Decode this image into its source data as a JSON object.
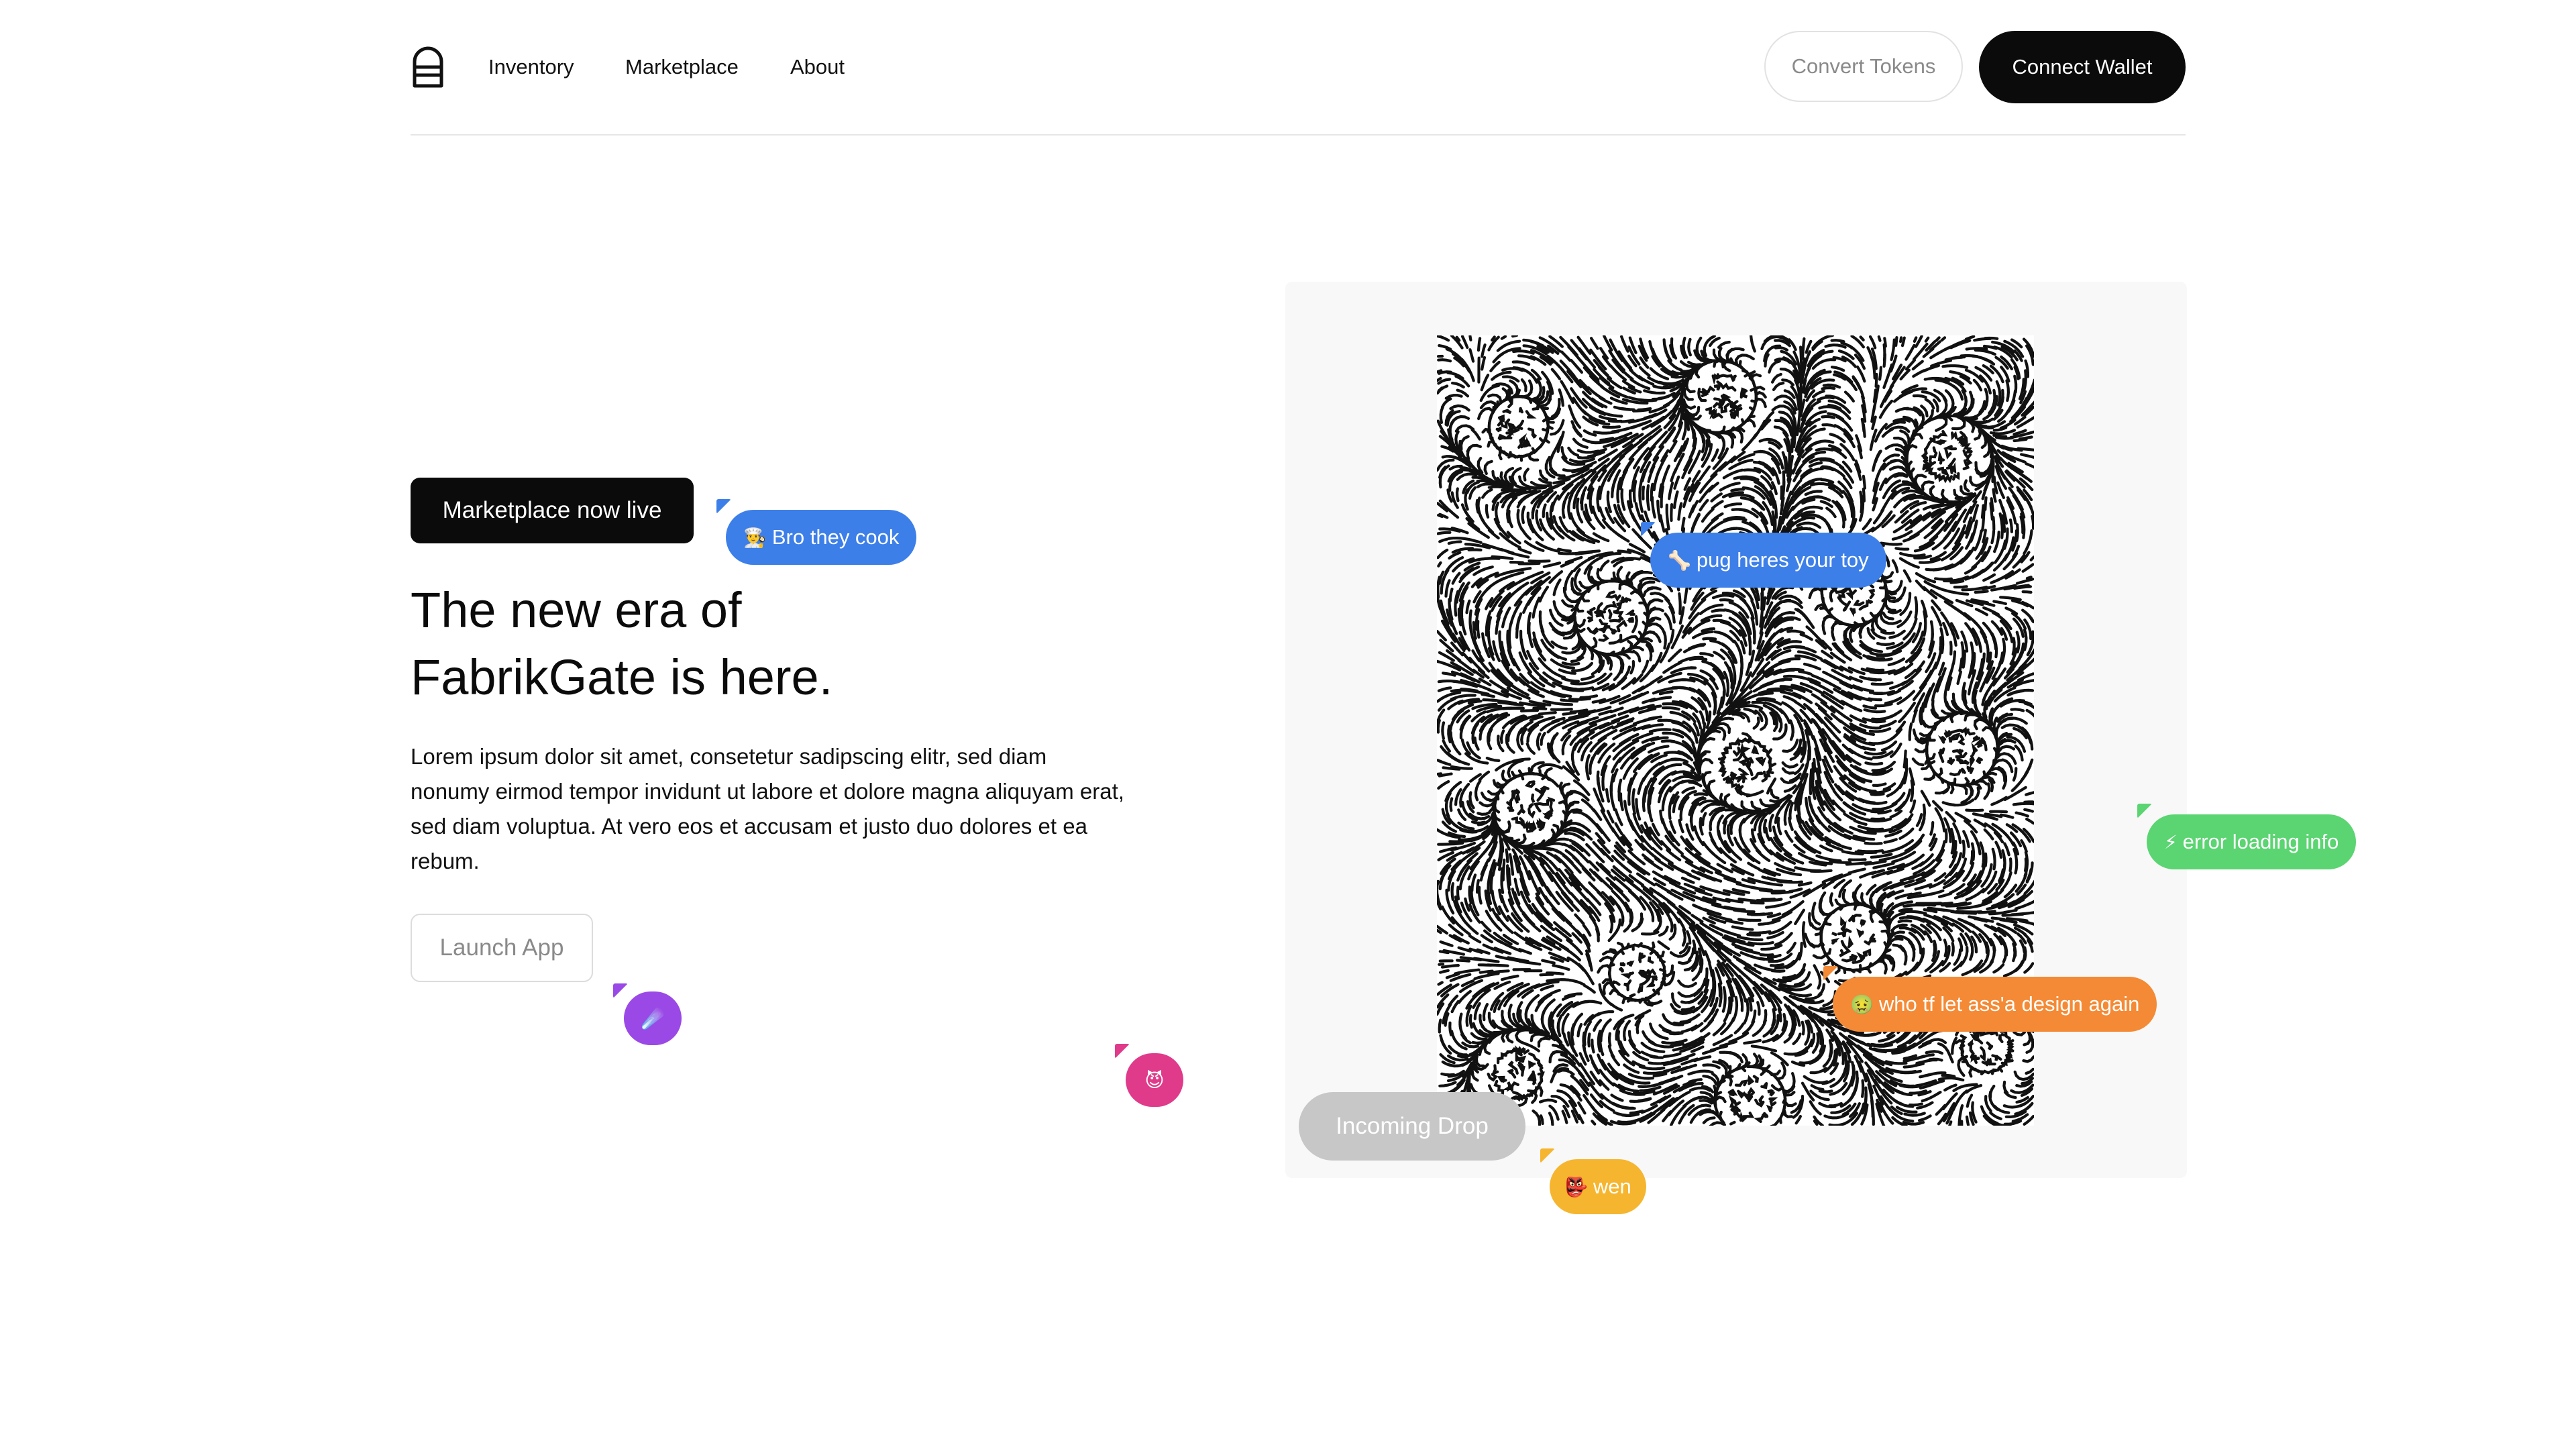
{
  "header": {
    "nav": [
      "Inventory",
      "Marketplace",
      "About"
    ],
    "convert_label": "Convert Tokens",
    "connect_label": "Connect Wallet"
  },
  "hero": {
    "badge": "Marketplace now live",
    "title_line1": "The new era of",
    "title_line2": "FabrikGate is here.",
    "body": "Lorem ipsum dolor sit amet, consetetur sadipscing elitr, sed diam nonumy eirmod tempor invidunt ut labore et dolore magna aliquyam erat, sed diam voluptua. At vero eos et accusam et justo duo dolores et ea rebum.",
    "launch_label": "Launch App"
  },
  "artwork": {
    "drop_label": "Incoming Drop"
  },
  "bubbles": [
    {
      "emoji": "👨‍🍳",
      "text": "Bro they cook",
      "color": "#3d7fe9"
    },
    {
      "emoji": "🦴",
      "text": "pug heres your toy",
      "color": "#3d7fe9"
    },
    {
      "emoji": "⚡",
      "text": "error loading info",
      "color": "#5bd472"
    },
    {
      "emoji": "🤢",
      "text": "who tf let ass'a design again",
      "color": "#f48a35"
    },
    {
      "emoji": "👺",
      "text": "wen",
      "color": "#f6b52e"
    },
    {
      "emoji": "☄️",
      "text": "",
      "color": "#9a49e6"
    },
    {
      "emoji": "😈",
      "text": "",
      "color": "#e03a8b"
    }
  ],
  "icons": {
    "logo": "fabrikgate-logo-icon"
  }
}
